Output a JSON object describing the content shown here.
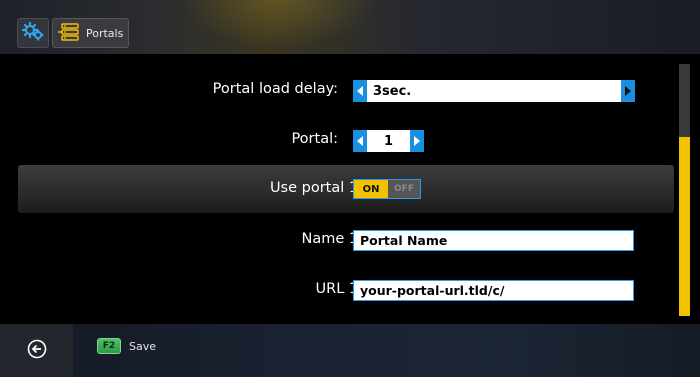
{
  "header": {
    "tab_label": "Portals",
    "icons": {
      "settings": "gear-icon",
      "portals": "portals-server-icon"
    }
  },
  "form": {
    "portal_load_delay": {
      "label": "Portal load delay:",
      "value": "3sec."
    },
    "portal": {
      "label": "Portal:",
      "value": "1"
    },
    "use_portal": {
      "label": "Use portal 1:",
      "on": "ON",
      "off": "OFF",
      "state": "on"
    },
    "name": {
      "label": "Name 1:",
      "value": "Portal Name"
    },
    "url": {
      "label": "URL 1:",
      "value": "your-portal-url.tld/c/"
    }
  },
  "footer": {
    "back_icon": "back-arrow-icon",
    "key": "F2",
    "save_label": "Save"
  },
  "colors": {
    "accent_blue": "#1a8fe0",
    "accent_yellow": "#f2c200",
    "key_green": "#3aae58"
  }
}
